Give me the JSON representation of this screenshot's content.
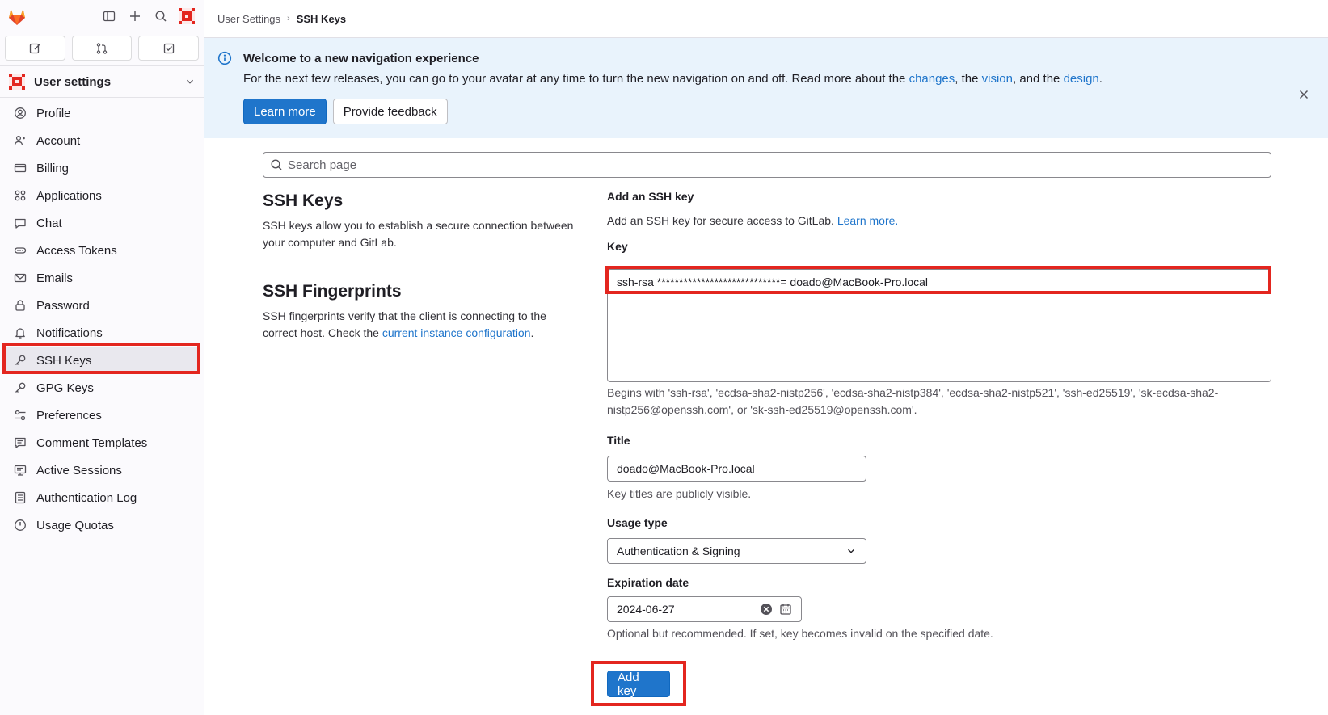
{
  "sidebar": {
    "context_title": "User settings",
    "items": [
      {
        "label": "Profile",
        "icon": "profile-icon"
      },
      {
        "label": "Account",
        "icon": "account-icon"
      },
      {
        "label": "Billing",
        "icon": "billing-icon"
      },
      {
        "label": "Applications",
        "icon": "applications-icon"
      },
      {
        "label": "Chat",
        "icon": "chat-icon"
      },
      {
        "label": "Access Tokens",
        "icon": "token-icon"
      },
      {
        "label": "Emails",
        "icon": "mail-icon"
      },
      {
        "label": "Password",
        "icon": "lock-icon"
      },
      {
        "label": "Notifications",
        "icon": "bell-icon"
      },
      {
        "label": "SSH Keys",
        "icon": "key-icon"
      },
      {
        "label": "GPG Keys",
        "icon": "key-icon"
      },
      {
        "label": "Preferences",
        "icon": "preferences-icon"
      },
      {
        "label": "Comment Templates",
        "icon": "comment-icon"
      },
      {
        "label": "Active Sessions",
        "icon": "monitor-icon"
      },
      {
        "label": "Authentication Log",
        "icon": "log-icon"
      },
      {
        "label": "Usage Quotas",
        "icon": "quota-icon"
      }
    ]
  },
  "breadcrumb": {
    "parent": "User Settings",
    "current": "SSH Keys"
  },
  "banner": {
    "title": "Welcome to a new navigation experience",
    "body_prefix": "For the next few releases, you can go to your avatar at any time to turn the new navigation on and off. Read more about the ",
    "link_changes": "changes",
    "sep1": ", the ",
    "link_vision": "vision",
    "sep2": ", and the ",
    "link_design": "design",
    "body_suffix": ".",
    "learn_more": "Learn more",
    "provide_feedback": "Provide feedback"
  },
  "search": {
    "placeholder": "Search page"
  },
  "left": {
    "ssh_title": "SSH Keys",
    "ssh_desc": "SSH keys allow you to establish a secure connection between your computer and GitLab.",
    "fp_title": "SSH Fingerprints",
    "fp_desc_prefix": "SSH fingerprints verify that the client is connecting to the correct host. Check the ",
    "fp_link": "current instance configuration",
    "fp_desc_suffix": "."
  },
  "form": {
    "heading": "Add an SSH key",
    "intro_prefix": "Add an SSH key for secure access to GitLab. ",
    "intro_link": "Learn more.",
    "key_label": "Key",
    "key_value": "ssh-rsa ****************************= doado@MacBook-Pro.local",
    "key_help": "Begins with 'ssh-rsa', 'ecdsa-sha2-nistp256', 'ecdsa-sha2-nistp384', 'ecdsa-sha2-nistp521', 'ssh-ed25519', 'sk-ecdsa-sha2-nistp256@openssh.com', or 'sk-ssh-ed25519@openssh.com'.",
    "title_label": "Title",
    "title_value": "doado@MacBook-Pro.local",
    "title_help": "Key titles are publicly visible.",
    "usage_label": "Usage type",
    "usage_value": "Authentication & Signing",
    "expiry_label": "Expiration date",
    "expiry_value": "2024-06-27",
    "expiry_help": "Optional but recommended. If set, key becomes invalid on the specified date.",
    "submit": "Add key"
  },
  "colors": {
    "primary": "#1f75cb",
    "highlight": "#e3261f",
    "banner_bg": "#e9f3fc"
  }
}
